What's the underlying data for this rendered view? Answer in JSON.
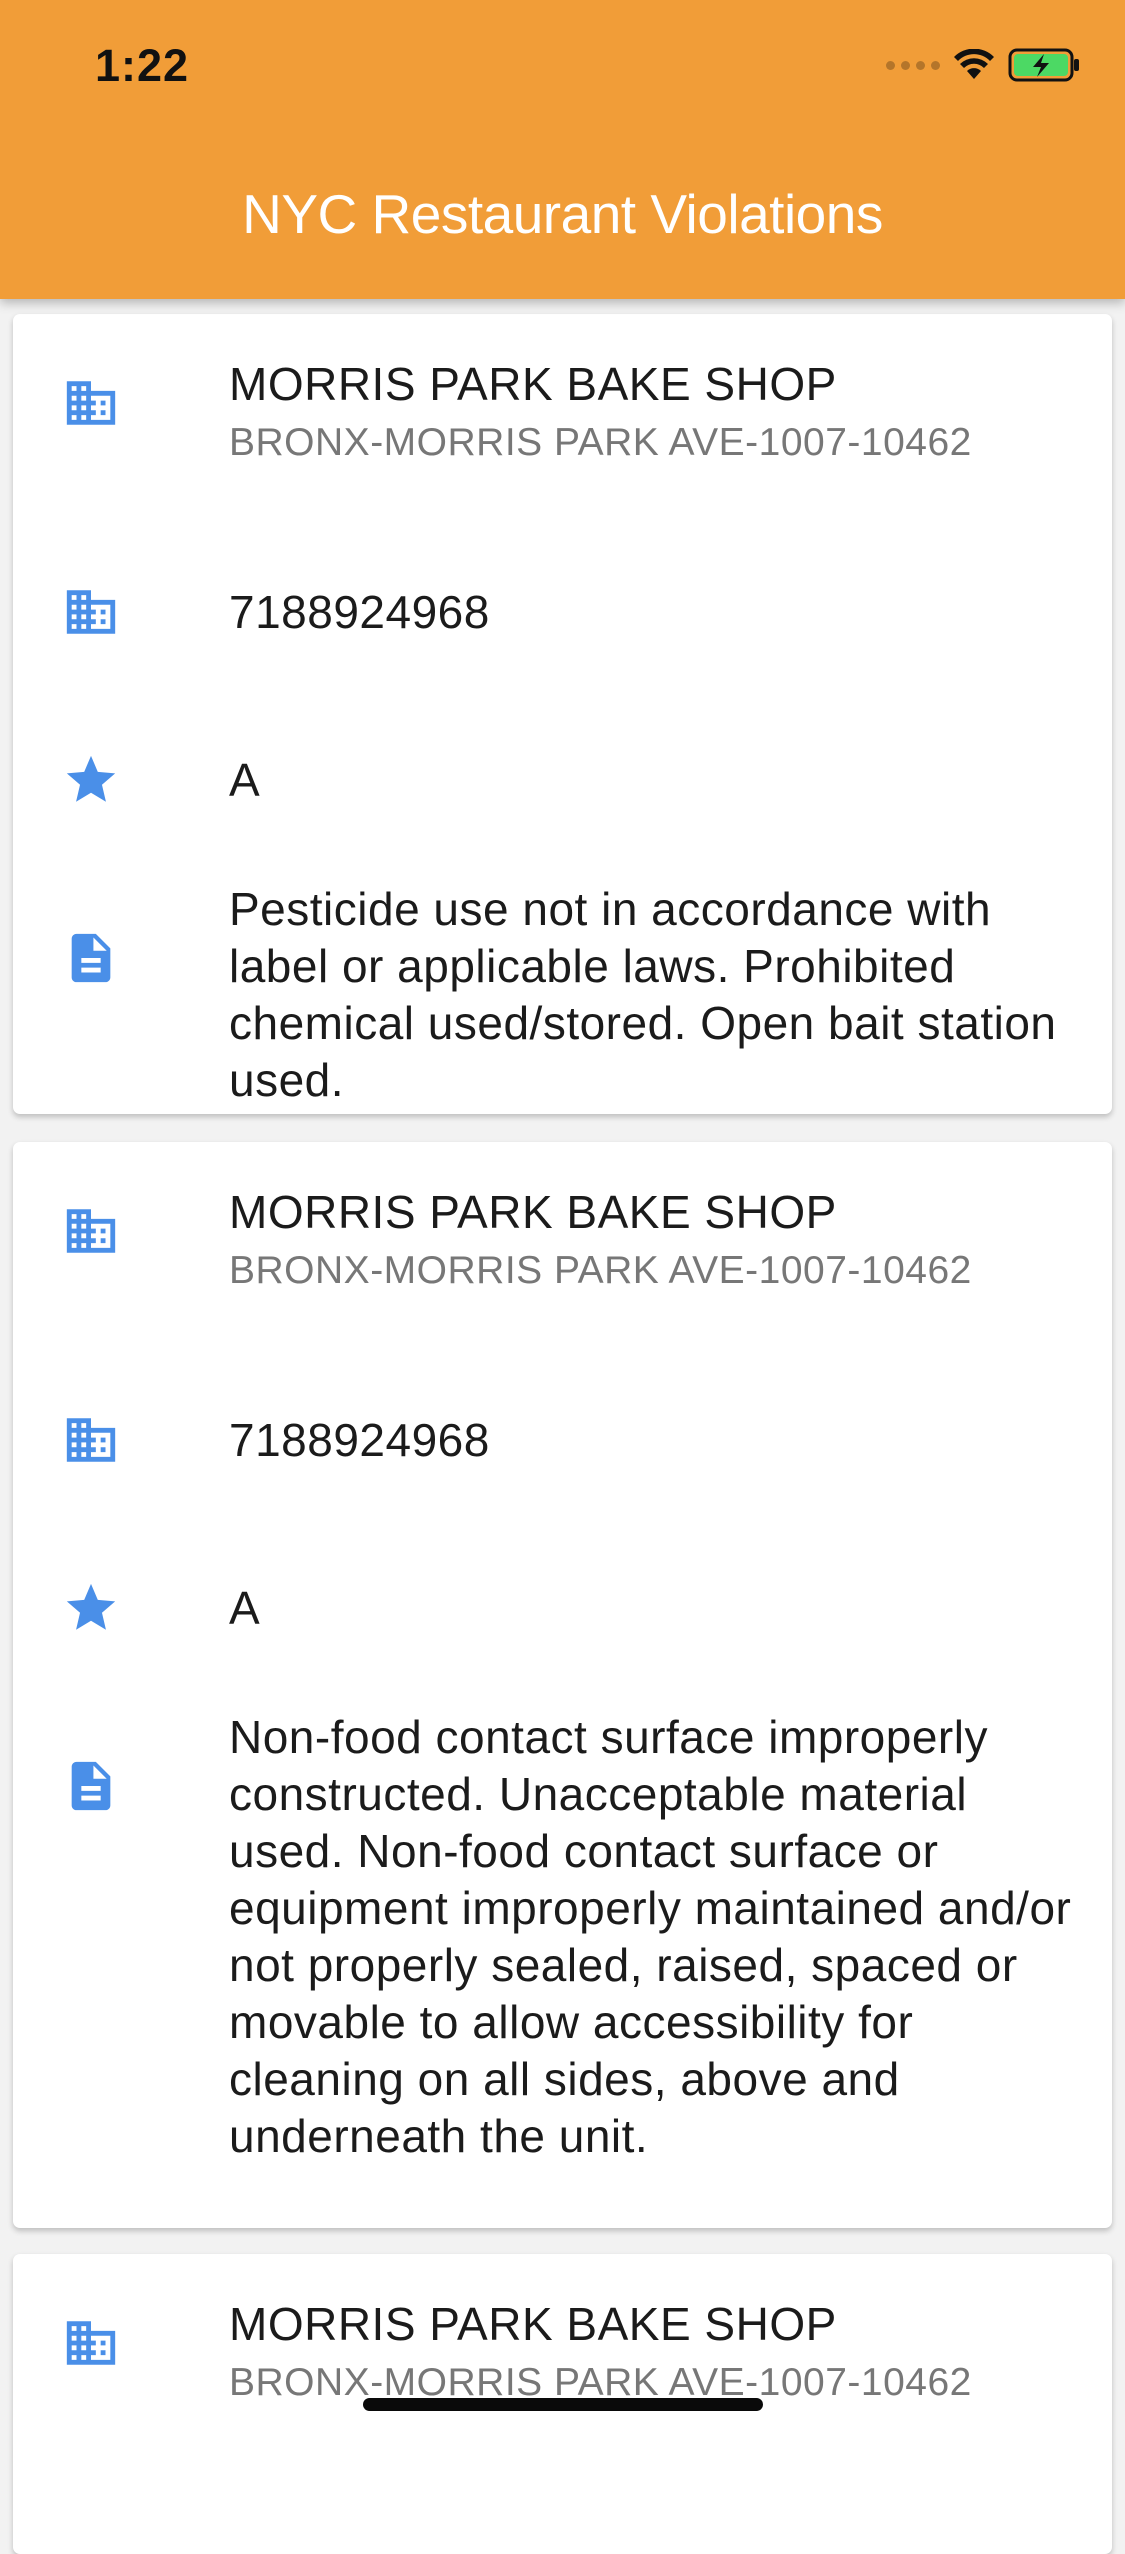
{
  "status_bar": {
    "time": "1:22"
  },
  "app_bar": {
    "title": "NYC Restaurant Violations",
    "color": "#f19d38"
  },
  "icon_color": "#4a8fe8",
  "violations": [
    {
      "name": "MORRIS PARK BAKE SHOP",
      "address": "BRONX-MORRIS PARK AVE-1007-10462",
      "phone": "7188924968",
      "grade": "A",
      "description": "Pesticide use not in accordance with label or applicable laws. Prohibited chemical used/stored. Open bait station used."
    },
    {
      "name": "MORRIS PARK BAKE SHOP",
      "address": "BRONX-MORRIS PARK AVE-1007-10462",
      "phone": "7188924968",
      "grade": "A",
      "description": "Non-food contact surface improperly constructed. Unacceptable material used. Non-food contact surface or equipment improperly maintained and/or not properly sealed, raised, spaced or movable to allow accessibility for cleaning on all sides, above and underneath the unit."
    },
    {
      "name": "MORRIS PARK BAKE SHOP",
      "address": "BRONX-MORRIS PARK AVE-1007-10462"
    }
  ],
  "icons": {
    "name_row": "business-icon",
    "phone_row": "business-icon",
    "grade_row": "star-icon",
    "description_row": "description-icon"
  }
}
